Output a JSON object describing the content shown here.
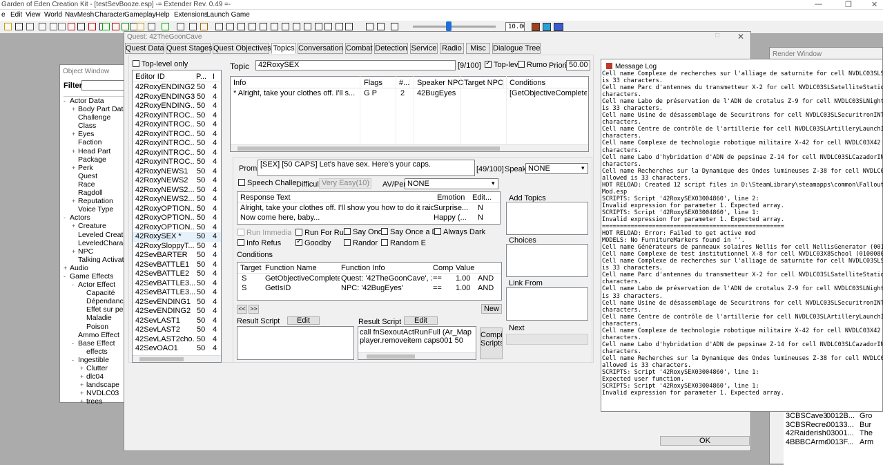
{
  "app": {
    "title": "Garden of Eden Creation Kit - [testSevBooze.esp] -= Extender Rev. 0.49 =-",
    "menu": [
      "e",
      "Edit",
      "View",
      "World",
      "NavMesh",
      "Character",
      "Gameplay",
      "Help",
      "Extensions",
      "Launch Game"
    ],
    "zoom_value": "10.00"
  },
  "object_window": {
    "title": "Object Window",
    "filter_label": "Filter",
    "tree": [
      {
        "t": "Actor Data",
        "d": 0,
        "e": "-"
      },
      {
        "t": "Body Part Data",
        "d": 1,
        "e": "+"
      },
      {
        "t": "Challenge",
        "d": 1,
        "e": ""
      },
      {
        "t": "Class",
        "d": 1,
        "e": ""
      },
      {
        "t": "Eyes",
        "d": 1,
        "e": "+"
      },
      {
        "t": "Faction",
        "d": 1,
        "e": ""
      },
      {
        "t": "Head Part",
        "d": 1,
        "e": "+"
      },
      {
        "t": "Package",
        "d": 1,
        "e": ""
      },
      {
        "t": "Perk",
        "d": 1,
        "e": "+"
      },
      {
        "t": "Quest",
        "d": 1,
        "e": ""
      },
      {
        "t": "Race",
        "d": 1,
        "e": ""
      },
      {
        "t": "Ragdoll",
        "d": 1,
        "e": ""
      },
      {
        "t": "Reputation",
        "d": 1,
        "e": "+"
      },
      {
        "t": "Voice Type",
        "d": 1,
        "e": ""
      },
      {
        "t": "Actors",
        "d": 0,
        "e": "-"
      },
      {
        "t": "Creature",
        "d": 1,
        "e": "+"
      },
      {
        "t": "Leveled Creature",
        "d": 1,
        "e": ""
      },
      {
        "t": "LeveledCharacter",
        "d": 1,
        "e": ""
      },
      {
        "t": "NPC",
        "d": 1,
        "e": "+"
      },
      {
        "t": "Talking Activator",
        "d": 1,
        "e": ""
      },
      {
        "t": "Audio",
        "d": 0,
        "e": "+"
      },
      {
        "t": "Game Effects",
        "d": 0,
        "e": "-"
      },
      {
        "t": "Actor Effect",
        "d": 1,
        "e": "-"
      },
      {
        "t": "Capacité",
        "d": 2,
        "e": ""
      },
      {
        "t": "Dépendance",
        "d": 2,
        "e": ""
      },
      {
        "t": "Effet sur personnage",
        "d": 2,
        "e": ""
      },
      {
        "t": "Maladie",
        "d": 2,
        "e": ""
      },
      {
        "t": "Poison",
        "d": 2,
        "e": ""
      },
      {
        "t": "Ammo Effect",
        "d": 1,
        "e": ""
      },
      {
        "t": "Base Effect",
        "d": 1,
        "e": "-"
      },
      {
        "t": "effects",
        "d": 2,
        "e": ""
      },
      {
        "t": "Ingestible",
        "d": 1,
        "e": "-"
      },
      {
        "t": "Clutter",
        "d": 2,
        "e": "+"
      },
      {
        "t": "dlc04",
        "d": 2,
        "e": "+"
      },
      {
        "t": "landscape",
        "d": 2,
        "e": "+"
      },
      {
        "t": "NVDLC03",
        "d": 2,
        "e": "+"
      },
      {
        "t": "trees",
        "d": 2,
        "e": "+"
      }
    ]
  },
  "quest": {
    "title": "Quest: 42TheGoonCave",
    "tabs": [
      "Quest Data",
      "Quest Stages",
      "Quest Objectives",
      "Topics",
      "Conversation",
      "Combat",
      "Detection",
      "Service",
      "Radio",
      "Misc",
      "Dialogue Tree"
    ],
    "active_tab": "Topics",
    "toplevel_only": "Top-level only",
    "editor_cols": [
      "Editor ID",
      "P...",
      "I"
    ],
    "editor_rows": [
      [
        "42RoxyENDING2",
        "50",
        "4"
      ],
      [
        "42RoxyENDING3",
        "50",
        "4"
      ],
      [
        "42RoxyENDING...",
        "50",
        "4"
      ],
      [
        "42RoxyINTROC...",
        "50",
        "4"
      ],
      [
        "42RoxyINTROC...",
        "50",
        "4"
      ],
      [
        "42RoxyINTROC...",
        "50",
        "4"
      ],
      [
        "42RoxyINTROC...",
        "50",
        "4"
      ],
      [
        "42RoxyINTROC...",
        "50",
        "4"
      ],
      [
        "42RoxyINTROC...",
        "50",
        "4"
      ],
      [
        "42RoxyNEWS1",
        "50",
        "4"
      ],
      [
        "42RoxyNEWS2",
        "50",
        "4"
      ],
      [
        "42RoxyNEWS2...",
        "50",
        "4"
      ],
      [
        "42RoxyNEWS2...",
        "50",
        "4"
      ],
      [
        "42RoxyOPTION...",
        "50",
        "4"
      ],
      [
        "42RoxyOPTION...",
        "50",
        "4"
      ],
      [
        "42RoxyOPTION...",
        "50",
        "4"
      ],
      [
        "42RoxySEX *",
        "50",
        "4"
      ],
      [
        "42RoxySloppyT...",
        "50",
        "4"
      ],
      [
        "42SevBARTER",
        "50",
        "4"
      ],
      [
        "42SevBATTLE1",
        "50",
        "4"
      ],
      [
        "42SevBATTLE2",
        "50",
        "4"
      ],
      [
        "42SevBATTLE3...",
        "50",
        "4"
      ],
      [
        "42SevBATTLE3...",
        "50",
        "4"
      ],
      [
        "42SevENDING1",
        "50",
        "4"
      ],
      [
        "42SevENDING2",
        "50",
        "4"
      ],
      [
        "42SevLAST1",
        "50",
        "4"
      ],
      [
        "42SevLAST2",
        "50",
        "4"
      ],
      [
        "42SevLAST2cho...",
        "50",
        "4"
      ],
      [
        "42SevOAO1",
        "50",
        "4"
      ]
    ],
    "topic_label": "Topic",
    "topic_value": "42RoxySEX",
    "topic_count": "[9/100]",
    "toplevel_chk": "Top-lev",
    "rumor_chk": "Rumo",
    "priority_label": "Priori",
    "priority_value": "50.00",
    "info_cols": [
      "Info",
      "Flags",
      "#...",
      "Speaker NPC",
      "Target NPC",
      "Conditions"
    ],
    "info_rows": [
      [
        "* Alright, take your clothes off. I'll s...",
        "G  P",
        "2",
        "42BugEyes",
        "",
        "[GetObjectiveCompleted 4"
      ]
    ],
    "prompt_label": "Prom",
    "prompt_value": "[SEX] [50 CAPS] Let's have sex. Here's your caps.",
    "prompt_count": "[49/100]",
    "speak_label": "Speak",
    "speak_value": "NONE",
    "speech_chk": "Speech Challe",
    "difficulty_label": "Difficult",
    "difficulty_value": "Very Easy(10)",
    "avper_label": "AV/Per",
    "avper_value": "NONE",
    "resp_cols": [
      "Response Text",
      "Emotion",
      "Edit..."
    ],
    "resp_rows": [
      [
        "Alright, take your clothes off. I'll show you how to do it raider ...",
        "Surprise...",
        "N"
      ],
      [
        "Now come here, baby...",
        "Happy (...",
        "N"
      ]
    ],
    "add_topics": "Add Topics",
    "choices": "Choices",
    "link_from": "Link From",
    "next": "Next",
    "checks": [
      {
        "l": "Run Immedia",
        "on": false,
        "dis": true
      },
      {
        "l": "Run For Rum",
        "on": false
      },
      {
        "l": "Say Onc",
        "on": false
      },
      {
        "l": "Say Once a D",
        "on": false
      },
      {
        "l": "Always Dark",
        "on": false
      },
      {
        "l": "Info Refus",
        "on": false
      },
      {
        "l": "Goodby",
        "on": true
      },
      {
        "l": "Randor",
        "on": false
      },
      {
        "l": "Random E",
        "on": false
      }
    ],
    "conditions_label": "Conditions",
    "cond_cols": [
      "Target",
      "Function Name",
      "Function Info",
      "Comp",
      "Value",
      ""
    ],
    "cond_rows": [
      [
        "S",
        "GetObjectiveCompleted",
        "Quest: '42TheGoonCave', 20",
        "==",
        "1.00",
        "AND"
      ],
      [
        "S",
        "GetIsID",
        "NPC: '42BugEyes'",
        "==",
        "1.00",
        "AND"
      ]
    ],
    "nav_prev": "<<",
    "nav_next": ">>",
    "new_btn": "New",
    "result_script": "Result Script",
    "edit_btn": "Edit",
    "result_script2_lines": [
      "call fnSexoutActRunFull (Ar_Map \"Ac",
      "player.removeitem caps001 50"
    ],
    "compile_btn": "Compile Scripts",
    "ok_btn": "OK"
  },
  "render_window": {
    "title": "Render Window",
    "rows": [
      [
        "3CBSCave3",
        "0012B...",
        "Gro"
      ],
      [
        "3CBSRecreatio...",
        "00133...",
        "Bur"
      ],
      [
        "42Raiderish",
        "03001...",
        "The"
      ],
      [
        "4BBBCArmory",
        "0013F...",
        "Arm"
      ]
    ]
  },
  "message_log": {
    "title": "Message Log",
    "lines": [
      "Cell name Complexe de recherches sur l'alliage de saturnite for cell NVDLC03SLSaturnite",
      "is 33 characters.",
      "Cell name Parc d'antennes du transmetteur X-2 for cell NVDLC03SLSatelliteStationINT (01",
      "characters.",
      "Cell name Labo de préservation de l'ADN de crotalus Z-9 for cell NVDLC03SLNightstalker",
      "is 33 characters.",
      "Cell name Usine de désassemblage de Securitrons for cell NVDLC03SLSecuritronINT (01007",
      "characters.",
      "Cell name Centre de contrôle de l'artillerie for cell NVDLC03SLArtilleryLaunchINT (0100",
      "characters.",
      "Cell name Complexe de technologie robotique militaire X-42 for cell NVDLC03X42 (01002E",
      "characters.",
      "Cell name Labo d'hybridation d'ADN de pepsinae Z-14 for cell NVDLC03SLCazadorINT (0100",
      "characters.",
      "Cell name Recherches sur la Dynamique des Ondes lumineuses Z-38 for cell NVDLC03SLHolog",
      "allowed is 33 characters.",
      "HOT RELOAD: Created 12 script files in D:\\SteamLibrary\\steamapps\\common\\Fallout New Veg",
      "Mod.esp",
      "SCRIPTS: Script '42RoxySEX03004860', line 2:",
      "Invalid expression for parameter 1. Expected array.",
      "SCRIPTS: Script '42RoxySEX03004860', line 1:",
      "Invalid expression for parameter 1. Expected array.",
      "===================================================",
      "HOT RELOAD: Error: Failed to get active mod",
      "MODELS: No FurnitureMarkers found in ''.",
      "Cell name Générateurs de panneaux solaires Nellis for cell NellisGenerator (00101A46) i",
      "Cell name Complexe de test institutionnel X-8 for cell NVDLC03X8School (01000803) is to",
      "Cell name Complexe de recherches sur l'alliage de saturnite for cell NVDLC03SLSaturnite",
      "is 33 characters.",
      "Cell name Parc d'antennes du transmetteur X-2 for cell NVDLC03SLSatelliteStationINT (01",
      "characters.",
      "Cell name Labo de préservation de l'ADN de crotalus Z-9 for cell NVDLC03SLNightstalker",
      "is 33 characters.",
      "Cell name Usine de désassemblage de Securitrons for cell NVDLC03SLSecuritronINT (01007",
      "characters.",
      "Cell name Centre de contrôle de l'artillerie for cell NVDLC03SLArtilleryLaunchINT (0100",
      "characters.",
      "Cell name Complexe de technologie robotique militaire X-42 for cell NVDLC03X42 (01002E",
      "characters.",
      "Cell name Labo d'hybridation d'ADN de pepsinae Z-14 for cell NVDLC03SLCazadorINT (0100",
      "characters.",
      "Cell name Recherches sur la Dynamique des Ondes lumineuses Z-38 for cell NVDLC03SLHolog",
      "allowed is 33 characters.",
      "SCRIPTS: Script '42RoxySEX03004860', line 1:",
      "Expected user function.",
      "SCRIPTS: Script '42RoxySEX03004860', line 1:",
      "Invalid expression for parameter 1. Expected array."
    ]
  }
}
